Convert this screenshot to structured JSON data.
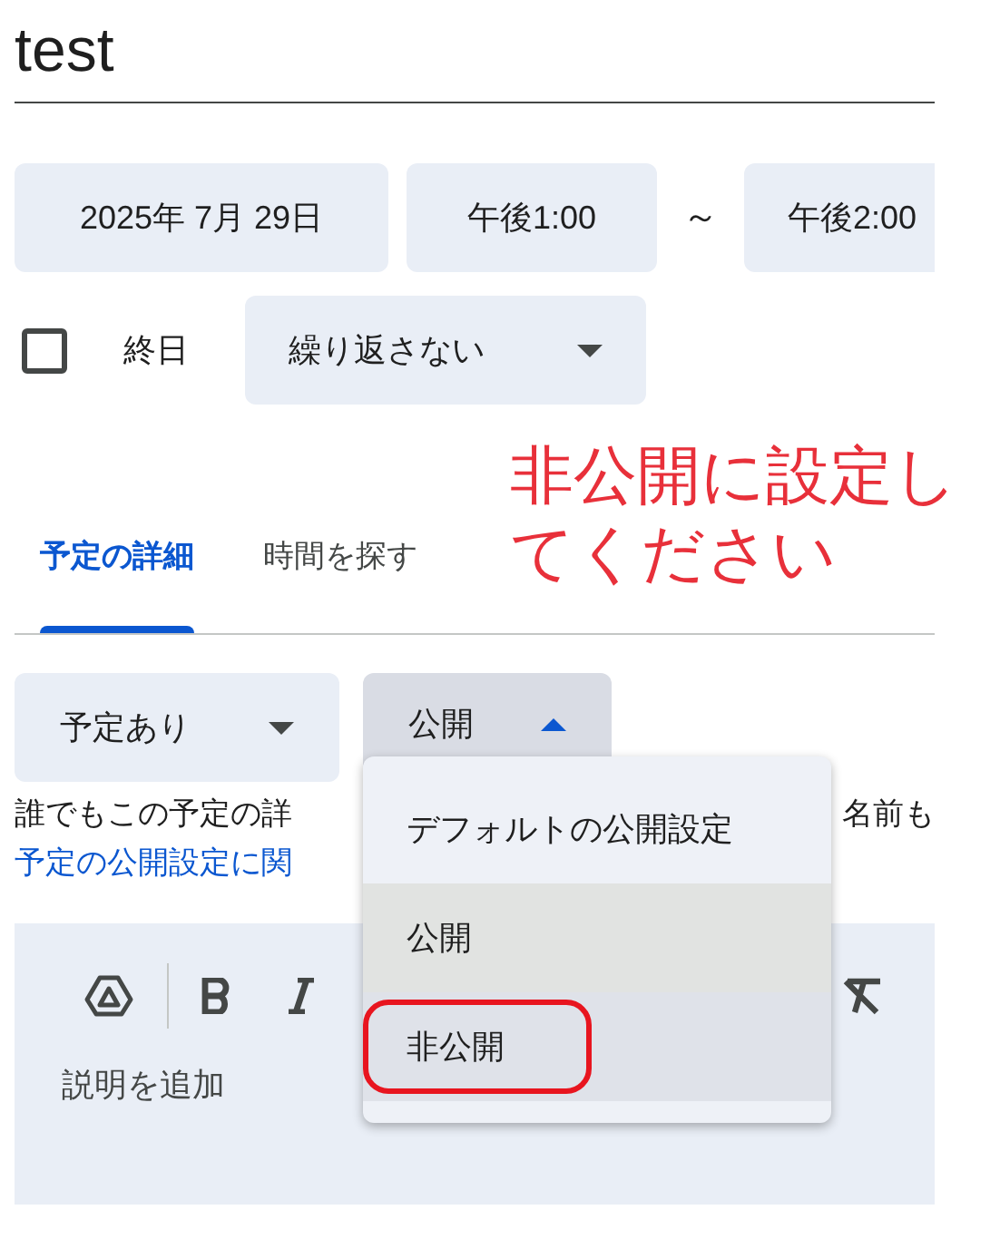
{
  "title": "test",
  "date": "2025年 7月 29日",
  "start_time": "午後1:00",
  "separator": "～",
  "end_time": "午後2:00",
  "all_day": {
    "label": "終日",
    "checked": false
  },
  "repeat": "繰り返さない",
  "tabs": [
    {
      "label": "予定の詳細",
      "selected": true
    },
    {
      "label": "時間を探す",
      "selected": false
    }
  ],
  "availability": "予定あり",
  "visibility": {
    "value": "公開",
    "expanded": true
  },
  "description_left": "誰でもこの予定の詳",
  "description_right": "名前も",
  "link": "予定の公開設定に関",
  "menu": [
    {
      "label": "デフォルトの公開設定",
      "selected": false,
      "hovered": false,
      "circled": false
    },
    {
      "label": "公開",
      "selected": true,
      "hovered": false,
      "circled": false
    },
    {
      "label": "非公開",
      "selected": false,
      "hovered": true,
      "circled": true
    }
  ],
  "editor": {
    "placeholder": "説明を追加"
  },
  "annotation": "非公開に設定してください"
}
